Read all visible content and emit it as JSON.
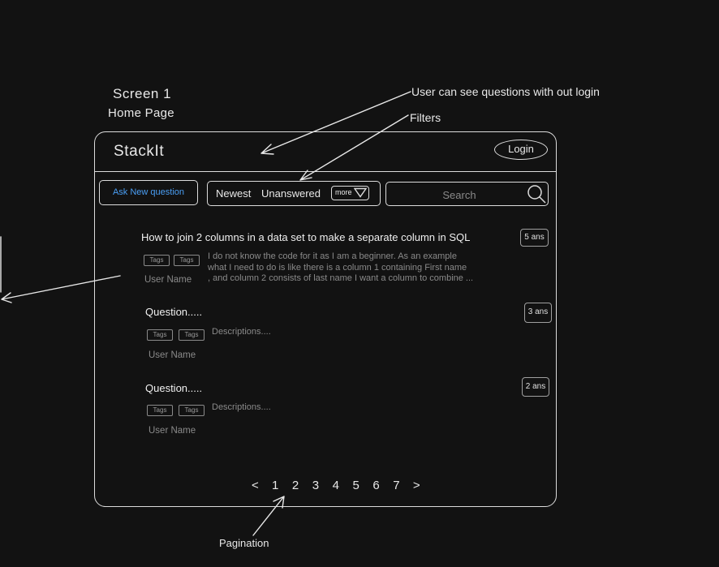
{
  "annotations": {
    "screen_title": "Screen 1",
    "page_subtitle": "Home Page",
    "no_login_note": "User can see questions with out login",
    "filters_note": "Filters",
    "pagination_note": "Pagination"
  },
  "header": {
    "brand": "StackIt",
    "login_label": "Login"
  },
  "toolbar": {
    "ask_label": "Ask New question",
    "filters": [
      "Newest",
      "Unanswered"
    ],
    "more_label": "more",
    "search_placeholder": "Search"
  },
  "questions": [
    {
      "title": "How to join 2 columns in a data set to make a separate column in SQL",
      "answers": "5 ans",
      "tags": [
        "Tags",
        "Tags"
      ],
      "description_lines": [
        "I do not know the code for it as I am a beginner. As an example",
        "what I need to do is like there is a column 1 containing First name",
        ", and column 2 consists of last name I want a column to combine ..."
      ],
      "user": "User Name"
    },
    {
      "title": "Question.....",
      "answers": "3 ans",
      "tags": [
        "Tags",
        "Tags"
      ],
      "description_lines": [
        "Descriptions...."
      ],
      "user": "User Name"
    },
    {
      "title": "Question.....",
      "answers": "2 ans",
      "tags": [
        "Tags",
        "Tags"
      ],
      "description_lines": [
        "Descriptions...."
      ],
      "user": "User Name"
    }
  ],
  "pagination": {
    "prev": "<",
    "pages": [
      "1",
      "2",
      "3",
      "4",
      "5",
      "6",
      "7"
    ],
    "next": ">"
  },
  "colors": {
    "background": "#121212",
    "stroke": "#dcdcdc",
    "accent": "#4a9ff5",
    "muted_text": "#8a8a8a"
  }
}
